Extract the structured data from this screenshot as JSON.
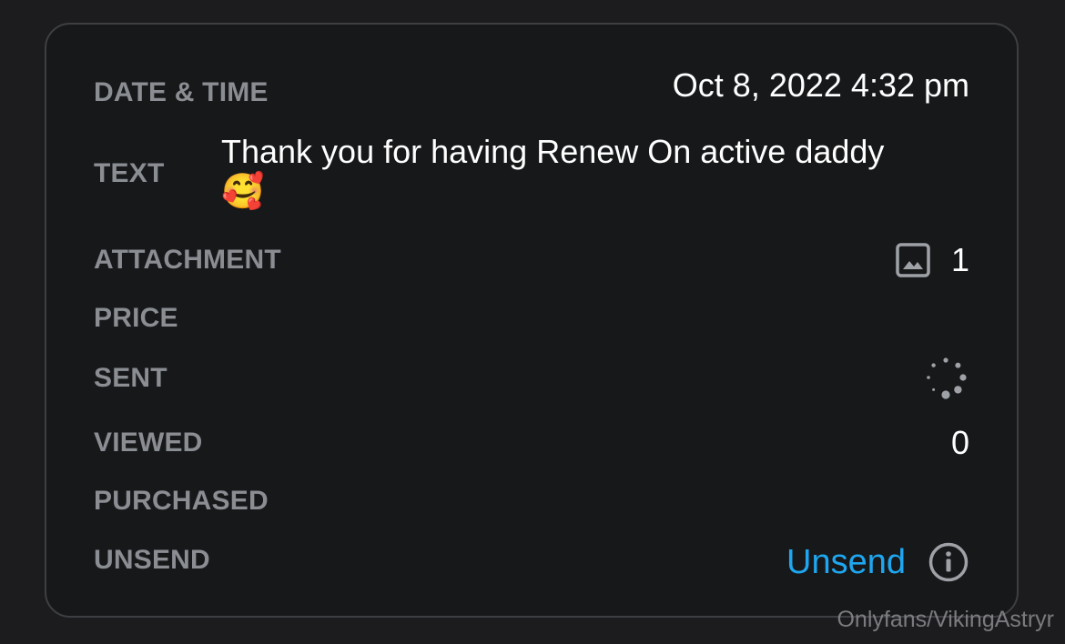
{
  "details": {
    "date_time": {
      "label": "DATE & TIME",
      "value": "Oct 8, 2022 4:32 pm"
    },
    "text": {
      "label": "TEXT",
      "value": "Thank you for having Renew On active daddy",
      "emoji": "🥰"
    },
    "attachment": {
      "label": "ATTACHMENT",
      "icon": "image-icon",
      "count": "1"
    },
    "price": {
      "label": "PRICE"
    },
    "sent": {
      "label": "SENT",
      "icon": "loading-spinner-icon"
    },
    "viewed": {
      "label": "VIEWED",
      "value": "0"
    },
    "purchased": {
      "label": "PURCHASED"
    },
    "unsend": {
      "label": "UNSEND",
      "action_label": "Unsend",
      "info_icon": "info-icon"
    }
  },
  "colors": {
    "background": "#17181a",
    "border": "#3d3f43",
    "label": "#8a8d92",
    "value": "#ffffff",
    "link": "#1ea7f0",
    "icon": "#9ea1a6"
  },
  "watermark": "Onlyfans/VikingAstryr"
}
